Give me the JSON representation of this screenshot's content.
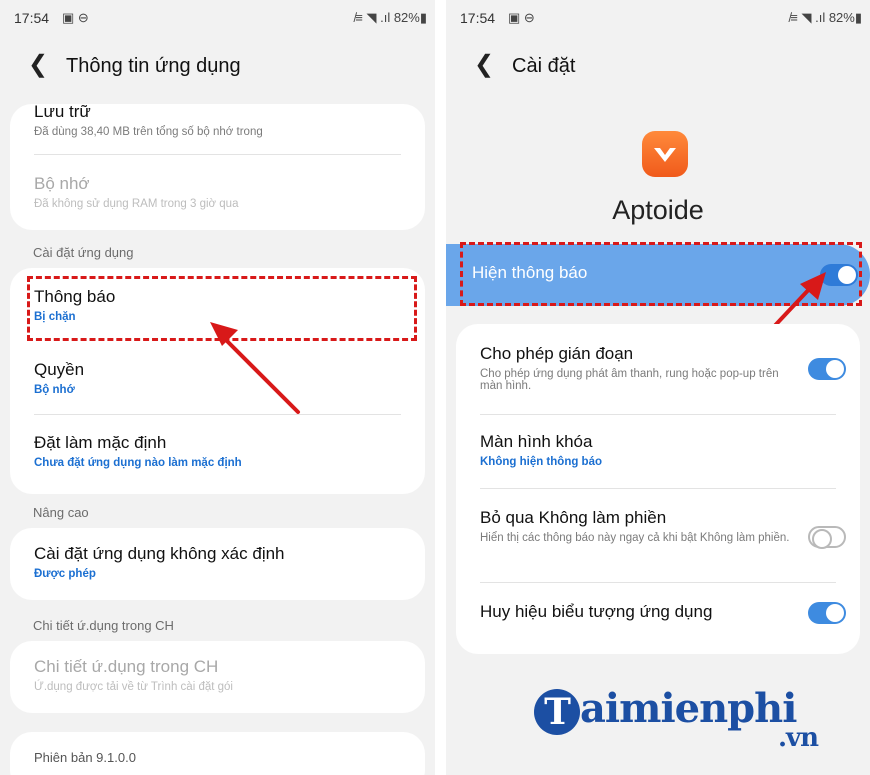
{
  "left": {
    "status": {
      "time": "17:54",
      "icons": "▣ ⊖",
      "right": "̸≡ ◥ .ıl 82%▮"
    },
    "title": "Thông tin ứng dụng",
    "storage": {
      "title": "Lưu trữ",
      "subtitle": "Đã dùng 38,40 MB trên tổng số bộ nhớ trong"
    },
    "memory": {
      "title": "Bộ nhớ",
      "subtitle": "Đã không sử dụng RAM trong 3 giờ qua"
    },
    "section_app_settings": "Cài đặt ứng dụng",
    "notifications": {
      "title": "Thông báo",
      "subtitle": "Bị chặn"
    },
    "permissions": {
      "title": "Quyền",
      "subtitle": "Bộ nhớ"
    },
    "defaults": {
      "title": "Đặt làm mặc định",
      "subtitle": "Chưa đặt ứng dụng nào làm mặc định"
    },
    "section_advanced": "Nâng cao",
    "unknown_sources": {
      "title": "Cài đặt ứng dụng không xác định",
      "subtitle": "Được phép"
    },
    "section_store": "Chi tiết ứ.dụng trong CH",
    "store_details": {
      "title": "Chi tiết ứ.dụng trong CH",
      "subtitle": "Ứ.dụng được tải về từ Trình cài đặt gói"
    },
    "version": "Phiên bản 9.1.0.0"
  },
  "right": {
    "status": {
      "time": "17:54",
      "icons": "▣ ⊖",
      "right": "̸≡ ◥ .ıl 82%▮"
    },
    "title": "Cài đặt",
    "app_name": "Aptoide",
    "show_notifications": {
      "label": "Hiện thông báo",
      "enabled": true
    },
    "allow_interruptions": {
      "title": "Cho phép gián đoạn",
      "subtitle": "Cho phép ứng dụng phát âm thanh, rung hoặc pop-up trên màn hình.",
      "enabled": true
    },
    "lock_screen": {
      "title": "Màn hình khóa",
      "subtitle": "Không hiện thông báo"
    },
    "dnd_override": {
      "title": "Bỏ qua Không làm phiền",
      "subtitle": "Hiển thị các thông báo này ngay cả khi bật Không làm phiền.",
      "enabled": false
    },
    "app_icon_badges": {
      "title": "Huy hiệu biểu tượng ứng dụng",
      "enabled": true
    }
  },
  "watermark": {
    "brand": "aimienphi",
    "domain": ".vn"
  },
  "colors": {
    "accent": "#3e8be0",
    "highlight_band": "#6aa6ea",
    "annotation": "#d81919",
    "link_blue": "#1b6fd1",
    "app_icon": "#f05a1b"
  },
  "icons": {
    "back": "chevron-left-icon",
    "app": "aptoide-logo-icon"
  }
}
